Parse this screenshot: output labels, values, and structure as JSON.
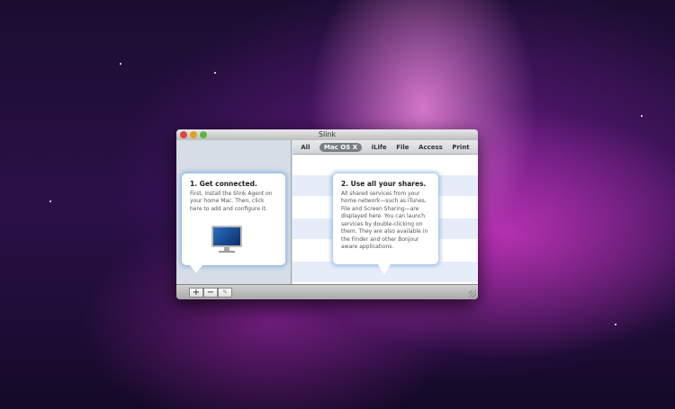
{
  "window": {
    "title": "Slink"
  },
  "tabs": [
    "All",
    "Mac OS X",
    "iLife",
    "File",
    "Access",
    "Print"
  ],
  "left_tip": {
    "title": "1. Get connected.",
    "body": "First, install the Slink Agent on your home Mac. Then, click here to add and configure it."
  },
  "right_tip": {
    "title": "2. Use all your shares.",
    "body": "All shared services from your home network—such as iTunes, File and Screen Sharing—are displayed here. You can launch services by double-clicking on them. They are also available in the Finder and other Bonjour aware applications."
  },
  "toolbar": {
    "add": "+",
    "remove": "−",
    "edit": "✎"
  }
}
